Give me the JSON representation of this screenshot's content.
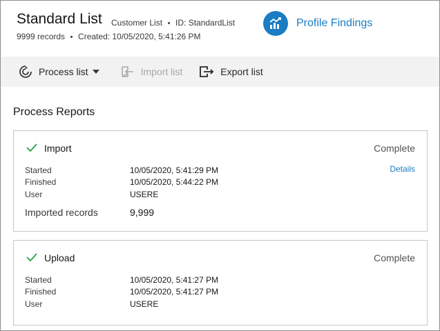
{
  "header": {
    "title": "Standard List",
    "list_type": "Customer List",
    "list_id": "ID: StandardList",
    "records": "9999 records",
    "created": "Created: 10/05/2020, 5:41:26 PM",
    "profile_label": "Profile Findings"
  },
  "toolbar": {
    "process_label": "Process list",
    "import_label": "Import list",
    "export_label": "Export list"
  },
  "main": {
    "section_title": "Process Reports",
    "reports": [
      {
        "name": "Import",
        "status": "Complete",
        "details_label": "Details",
        "started_label": "Started",
        "started": "10/05/2020, 5:41:29 PM",
        "finished_label": "Finished",
        "finished": "10/05/2020, 5:44:22 PM",
        "user_label": "User",
        "user": "USERE",
        "records_label": "Imported records",
        "records": "9,999"
      },
      {
        "name": "Upload",
        "status": "Complete",
        "started_label": "Started",
        "started": "10/05/2020, 5:41:27 PM",
        "finished_label": "Finished",
        "finished": "10/05/2020, 5:41:27 PM",
        "user_label": "User",
        "user": "USERE"
      }
    ]
  },
  "colors": {
    "accent": "#1a7dc4",
    "success": "#24a148",
    "toolbar_bg": "#f2f2f2"
  }
}
